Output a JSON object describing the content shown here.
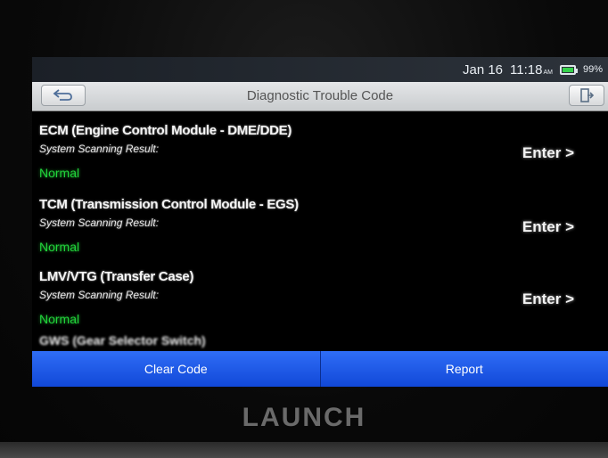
{
  "status_bar": {
    "date": "Jan 16",
    "time": "11:18",
    "ampm": "AM",
    "battery_percent": "99%"
  },
  "title_bar": {
    "title": "Diagnostic Trouble Code",
    "back_icon": "back-arrow-icon",
    "exit_icon": "exit-door-icon"
  },
  "modules": [
    {
      "name": "ECM (Engine Control Module - DME/DDE)",
      "scan_label": "System Scanning Result:",
      "result": "Normal",
      "enter_label": "Enter >"
    },
    {
      "name": "TCM (Transmission Control Module - EGS)",
      "scan_label": "System Scanning Result:",
      "result": "Normal",
      "enter_label": "Enter >"
    },
    {
      "name": "LMV/VTG (Transfer Case)",
      "scan_label": "System Scanning Result:",
      "result": "Normal",
      "enter_label": "Enter >"
    }
  ],
  "partial_item": "GWS (Gear Selector Switch)",
  "actions": {
    "clear_code": "Clear Code",
    "report": "Report"
  },
  "brand": "LAUNCH",
  "colors": {
    "accent_blue": "#1f5be8",
    "status_normal": "#21d53b",
    "battery_fill": "#35d24b"
  }
}
